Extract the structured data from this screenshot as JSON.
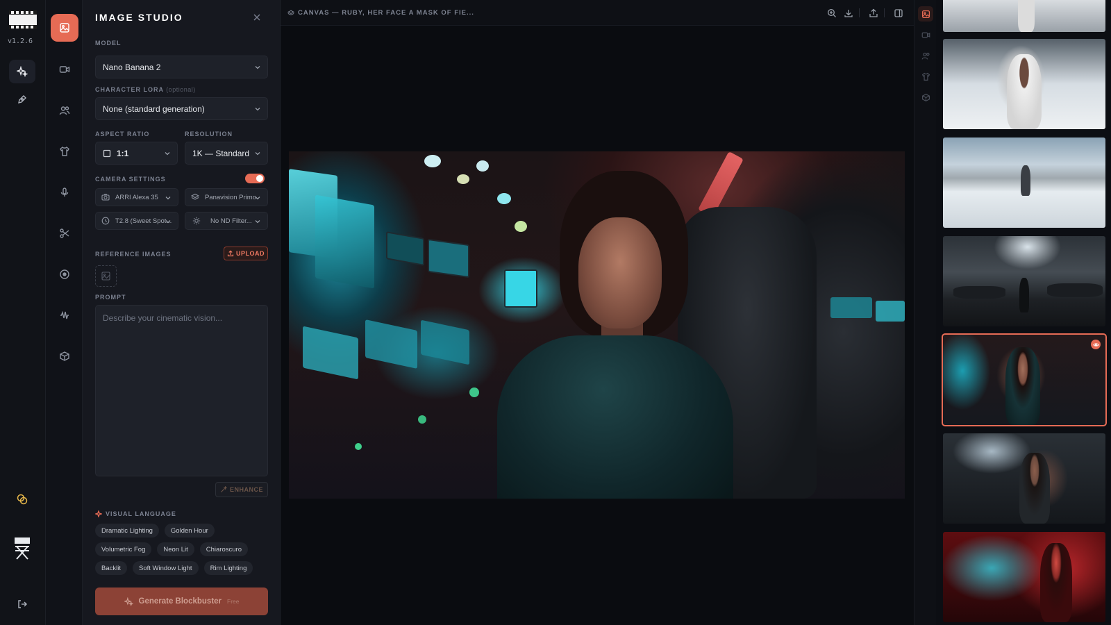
{
  "app": {
    "version": "v1.2.6"
  },
  "panel": {
    "title": "IMAGE STUDIO",
    "model_label": "MODEL",
    "model_value": "Nano Banana 2",
    "lora_label": "CHARACTER LORA",
    "lora_optional": "(optional)",
    "lora_value": "None (standard generation)",
    "aspect_label": "ASPECT RATIO",
    "aspect_value": "1:1",
    "resolution_label": "RESOLUTION",
    "resolution_value": "1K — Standard",
    "camera_label": "CAMERA SETTINGS",
    "camera_enabled": true,
    "camera_body": "ARRI Alexa 35",
    "lens": "Panavision Primo",
    "aperture": "T2.8 (Sweet Spot...",
    "nd_filter": "No ND Filter...",
    "reference_label": "REFERENCE IMAGES",
    "upload_label": "UPLOAD",
    "prompt_label": "PROMPT",
    "prompt_placeholder": "Describe your cinematic vision...",
    "enhance_label": "ENHANCE",
    "visual_language_label": "VISUAL LANGUAGE",
    "chips": [
      "Dramatic Lighting",
      "Golden Hour",
      "Volumetric Fog",
      "Neon Lit",
      "Chiaroscuro",
      "Backlit",
      "Soft Window Light",
      "Rim Lighting"
    ],
    "generate_label": "Generate Blockbuster",
    "generate_tag": "Free"
  },
  "canvas": {
    "title": "CANVAS — RUBY, HER FACE A MASK OF FIE..."
  },
  "colors": {
    "accent": "#e66b55",
    "panel_bg": "#16181f",
    "canvas_bg": "#0a0c10"
  }
}
